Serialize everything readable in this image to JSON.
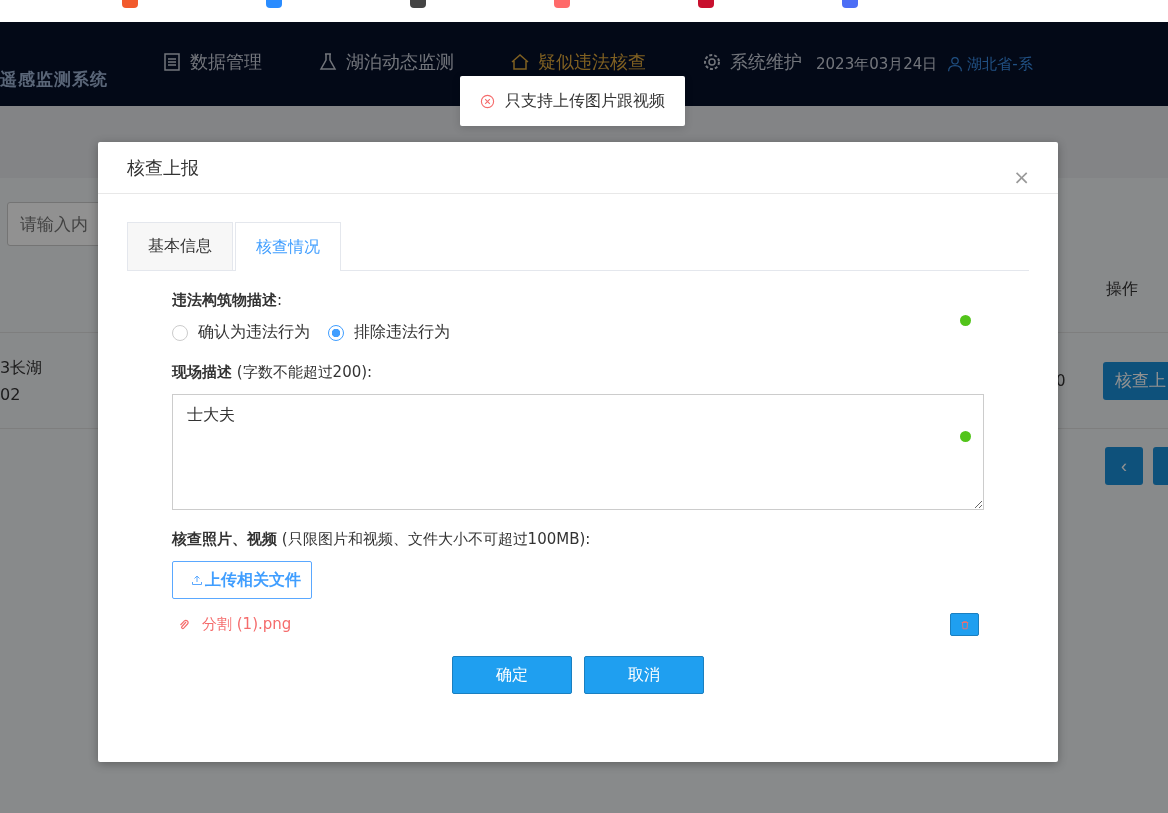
{
  "header": {
    "logo": "遥感监测系统",
    "nav": [
      {
        "label": "数据管理",
        "selected": false
      },
      {
        "label": "湖泊动态监测",
        "selected": false
      },
      {
        "label": "疑似违法核查",
        "selected": true
      },
      {
        "label": "系统维护",
        "selected": false
      }
    ],
    "date": "2023年03月24日",
    "user": "湖北省-系"
  },
  "toast": {
    "kind": "error",
    "message": "只支持上传图片跟视频"
  },
  "background": {
    "search": {
      "placeholder": "请输入内"
    },
    "table": {
      "columns": [
        "操作"
      ],
      "rows": [
        {
          "cells": [
            "3长湖",
            "02",
            "0"
          ],
          "action": "核查上"
        }
      ]
    },
    "pagination": [
      "‹"
    ]
  },
  "dialog": {
    "title": "核查上报",
    "close": "×",
    "tabs": [
      {
        "label": "基本信息",
        "selected": false
      },
      {
        "label": "核查情况",
        "selected": true
      }
    ],
    "fields": [
      {
        "kind": "radio",
        "label": "**违法构筑物描述**:",
        "valid": true,
        "options": [
          {
            "label": "确认为违法行为",
            "selected": false
          },
          {
            "label": "排除违法行为",
            "selected": true
          }
        ]
      },
      {
        "kind": "textarea",
        "label": "**现场描述** (字数不能超过200):",
        "valid": true,
        "value": "士大夫"
      },
      {
        "kind": "upload",
        "label": "**核查照片、视频** (只限图片和视频、文件大小不可超过100MB):",
        "button": "上传相关文件",
        "files": [
          {
            "name": "分割 (1).png"
          }
        ]
      }
    ],
    "buttons": [
      "确定",
      "取消"
    ]
  }
}
